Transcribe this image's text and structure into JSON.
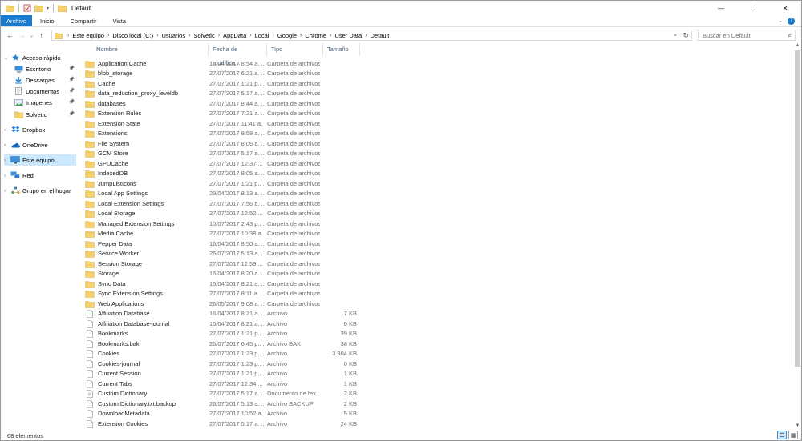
{
  "window": {
    "title": "Default",
    "controls": {
      "minimize": "—",
      "maximize": "☐",
      "close": "✕"
    }
  },
  "ribbon": {
    "tabs": [
      {
        "label": "Archivo",
        "active": true
      },
      {
        "label": "Inicio"
      },
      {
        "label": "Compartir"
      },
      {
        "label": "Vista"
      }
    ]
  },
  "address": {
    "crumbs": [
      "Este equipo",
      "Disco local (C:)",
      "Usuarios",
      "Solvetic",
      "AppData",
      "Local",
      "Google",
      "Chrome",
      "User Data",
      "Default"
    ]
  },
  "search": {
    "placeholder": "Buscar en Default"
  },
  "sidebar": {
    "items": [
      {
        "label": "Acceso rápido",
        "icon": "star-icon",
        "indent": 0,
        "expander": "open"
      },
      {
        "label": "Escritorio",
        "icon": "desktop-icon",
        "indent": 1,
        "pinned": true
      },
      {
        "label": "Descargas",
        "icon": "download-icon",
        "indent": 1,
        "pinned": true
      },
      {
        "label": "Documentos",
        "icon": "documents-icon",
        "indent": 1,
        "pinned": true
      },
      {
        "label": "Imágenes",
        "icon": "pictures-icon",
        "indent": 1,
        "pinned": true
      },
      {
        "label": "Solvetic",
        "icon": "folder-icon",
        "indent": 1,
        "pinned": true
      },
      {
        "label": "Dropbox",
        "icon": "dropbox-icon",
        "indent": 0,
        "expander": "closed"
      },
      {
        "label": "OneDrive",
        "icon": "onedrive-icon",
        "indent": 0,
        "expander": "closed"
      },
      {
        "label": "Este equipo",
        "icon": "computer-icon",
        "indent": 0,
        "expander": "closed",
        "selected": true
      },
      {
        "label": "Red",
        "icon": "network-icon",
        "indent": 0,
        "expander": "closed"
      },
      {
        "label": "Grupo en el hogar",
        "icon": "homegroup-icon",
        "indent": 0,
        "expander": "closed"
      }
    ]
  },
  "columns": {
    "name": "Nombre",
    "date": "Fecha de modifica...",
    "type": "Tipo",
    "size": "Tamaño"
  },
  "files": [
    {
      "name": "Application Cache",
      "date": "16/04/2017 8:54 a. ...",
      "type": "Carpeta de archivos",
      "size": "",
      "kind": "folder"
    },
    {
      "name": "blob_storage",
      "date": "27/07/2017 6:21 a. ...",
      "type": "Carpeta de archivos",
      "size": "",
      "kind": "folder"
    },
    {
      "name": "Cache",
      "date": "27/07/2017 1:21 p.. ...",
      "type": "Carpeta de archivos",
      "size": "",
      "kind": "folder"
    },
    {
      "name": "data_reduction_proxy_leveldb",
      "date": "27/07/2017 5:17 a. ...",
      "type": "Carpeta de archivos",
      "size": "",
      "kind": "folder"
    },
    {
      "name": "databases",
      "date": "27/07/2017 8:44 a. ...",
      "type": "Carpeta de archivos",
      "size": "",
      "kind": "folder"
    },
    {
      "name": "Extension Rules",
      "date": "27/07/2017 7:21 a. ...",
      "type": "Carpeta de archivos",
      "size": "",
      "kind": "folder"
    },
    {
      "name": "Extension State",
      "date": "27/07/2017 11:41 a. ...",
      "type": "Carpeta de archivos",
      "size": "",
      "kind": "folder"
    },
    {
      "name": "Extensions",
      "date": "27/07/2017 8:58 a. ...",
      "type": "Carpeta de archivos",
      "size": "",
      "kind": "folder"
    },
    {
      "name": "File System",
      "date": "27/07/2017 8:06 a. ...",
      "type": "Carpeta de archivos",
      "size": "",
      "kind": "folder"
    },
    {
      "name": "GCM Store",
      "date": "27/07/2017 5:17 a. ...",
      "type": "Carpeta de archivos",
      "size": "",
      "kind": "folder"
    },
    {
      "name": "GPUCache",
      "date": "27/07/2017 12:37 ...",
      "type": "Carpeta de archivos",
      "size": "",
      "kind": "folder"
    },
    {
      "name": "IndexedDB",
      "date": "27/07/2017 8:05 a. ...",
      "type": "Carpeta de archivos",
      "size": "",
      "kind": "folder"
    },
    {
      "name": "JumpListIcons",
      "date": "27/07/2017 1:21 p.. ...",
      "type": "Carpeta de archivos",
      "size": "",
      "kind": "folder"
    },
    {
      "name": "Local App Settings",
      "date": "29/04/2017 8:13 a. ...",
      "type": "Carpeta de archivos",
      "size": "",
      "kind": "folder"
    },
    {
      "name": "Local Extension Settings",
      "date": "27/07/2017 7:56 a. ...",
      "type": "Carpeta de archivos",
      "size": "",
      "kind": "folder"
    },
    {
      "name": "Local Storage",
      "date": "27/07/2017 12:52 ...",
      "type": "Carpeta de archivos",
      "size": "",
      "kind": "folder"
    },
    {
      "name": "Managed Extension Settings",
      "date": "10/07/2017 2:43 p.. ...",
      "type": "Carpeta de archivos",
      "size": "",
      "kind": "folder"
    },
    {
      "name": "Media Cache",
      "date": "27/07/2017 10:38 a. ...",
      "type": "Carpeta de archivos",
      "size": "",
      "kind": "folder"
    },
    {
      "name": "Pepper Data",
      "date": "16/04/2017 8:50 a. ...",
      "type": "Carpeta de archivos",
      "size": "",
      "kind": "folder"
    },
    {
      "name": "Service Worker",
      "date": "26/07/2017 5:13 a. ...",
      "type": "Carpeta de archivos",
      "size": "",
      "kind": "folder"
    },
    {
      "name": "Session Storage",
      "date": "27/07/2017 12:59 ...",
      "type": "Carpeta de archivos",
      "size": "",
      "kind": "folder"
    },
    {
      "name": "Storage",
      "date": "16/04/2017 8:20 a. ...",
      "type": "Carpeta de archivos",
      "size": "",
      "kind": "folder"
    },
    {
      "name": "Sync Data",
      "date": "16/04/2017 8:21 a. ...",
      "type": "Carpeta de archivos",
      "size": "",
      "kind": "folder"
    },
    {
      "name": "Sync Extension Settings",
      "date": "27/07/2017 8:11 a. ...",
      "type": "Carpeta de archivos",
      "size": "",
      "kind": "folder"
    },
    {
      "name": "Web Applications",
      "date": "26/05/2017 9:08 a. ...",
      "type": "Carpeta de archivos",
      "size": "",
      "kind": "folder"
    },
    {
      "name": "Affiliation Database",
      "date": "16/04/2017 8:21 a. ...",
      "type": "Archivo",
      "size": "7 KB",
      "kind": "file"
    },
    {
      "name": "Affiliation Database-journal",
      "date": "16/04/2017 8:21 a. ...",
      "type": "Archivo",
      "size": "0 KB",
      "kind": "file"
    },
    {
      "name": "Bookmarks",
      "date": "27/07/2017 1:21 p.. ...",
      "type": "Archivo",
      "size": "39 KB",
      "kind": "file"
    },
    {
      "name": "Bookmarks.bak",
      "date": "26/07/2017 6:45 p.. ...",
      "type": "Archivo BAK",
      "size": "38 KB",
      "kind": "file"
    },
    {
      "name": "Cookies",
      "date": "27/07/2017 1:23 p.. ...",
      "type": "Archivo",
      "size": "3.904 KB",
      "kind": "file"
    },
    {
      "name": "Cookies-journal",
      "date": "27/07/2017 1:23 p.. ...",
      "type": "Archivo",
      "size": "0 KB",
      "kind": "file"
    },
    {
      "name": "Current Session",
      "date": "27/07/2017 1:21 p.. ...",
      "type": "Archivo",
      "size": "1 KB",
      "kind": "file"
    },
    {
      "name": "Current Tabs",
      "date": "27/07/2017 12:34 ...",
      "type": "Archivo",
      "size": "1 KB",
      "kind": "file"
    },
    {
      "name": "Custom Dictionary",
      "date": "27/07/2017 5:17 a. ...",
      "type": "Documento de tex...",
      "size": "2 KB",
      "kind": "text"
    },
    {
      "name": "Custom Dictionary.txt.backup",
      "date": "26/07/2017 5:13 a. ...",
      "type": "Archivo BACKUP",
      "size": "2 KB",
      "kind": "file"
    },
    {
      "name": "DownloadMetadata",
      "date": "27/07/2017 10:52 a. ...",
      "type": "Archivo",
      "size": "5 KB",
      "kind": "file"
    },
    {
      "name": "Extension Cookies",
      "date": "27/07/2017 5:17 a. ...",
      "type": "Archivo",
      "size": "24 KB",
      "kind": "file"
    }
  ],
  "status": {
    "count": "68 elementos"
  },
  "colors": {
    "accent": "#1979ca",
    "folder": "#f6d36f",
    "selected": "#cce8ff"
  }
}
